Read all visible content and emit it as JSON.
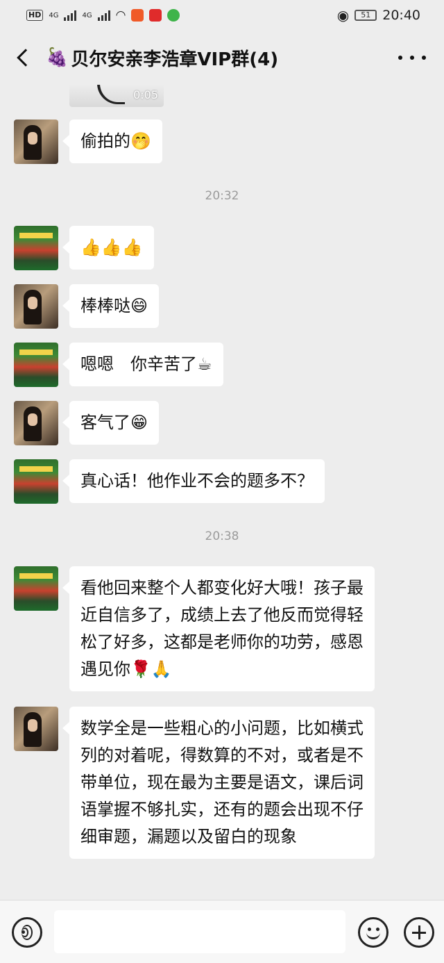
{
  "status_bar": {
    "hd_label": "HD",
    "net1": "4G",
    "net2": "4G",
    "battery": "51",
    "time": "20:40"
  },
  "header": {
    "title_emoji": "🍇",
    "title": "贝尔安亲李浩章VIP群(4)"
  },
  "chat": {
    "video_duration": "0:05",
    "messages": [
      {
        "sender": "a",
        "text": "偷拍的",
        "emoji": "🤭"
      },
      {
        "time": "20:32"
      },
      {
        "sender": "b",
        "text": "",
        "emoji": "👍👍👍"
      },
      {
        "sender": "a",
        "text": "棒棒哒",
        "emoji": "😄"
      },
      {
        "sender": "b",
        "text": "嗯嗯　你辛苦了",
        "emoji": "☕"
      },
      {
        "sender": "a",
        "text": "客气了",
        "emoji": "😁"
      },
      {
        "sender": "b",
        "text": "真心话！他作业不会的题多不？",
        "emoji": ""
      },
      {
        "time": "20:38"
      },
      {
        "sender": "b",
        "text": "看他回来整个人都变化好大哦！孩子最近自信多了，成绩上去了他反而觉得轻松了好多，这都是老师你的功劳，感恩遇见你",
        "emoji": "🌹🙏"
      },
      {
        "sender": "a",
        "text": "数学全是一些粗心的小问题，比如横式列的对着呢，得数算的不对，或者是不带单位，现在最为主要是语文，课后词语掌握不够扎实，还有的题会出现不仔细审题，漏题以及留白的现象",
        "emoji": ""
      }
    ]
  },
  "input_bar": {
    "placeholder": ""
  },
  "colors": {
    "background": "#ededed",
    "bubble": "#ffffff",
    "timestamp": "#9b9b9b"
  }
}
